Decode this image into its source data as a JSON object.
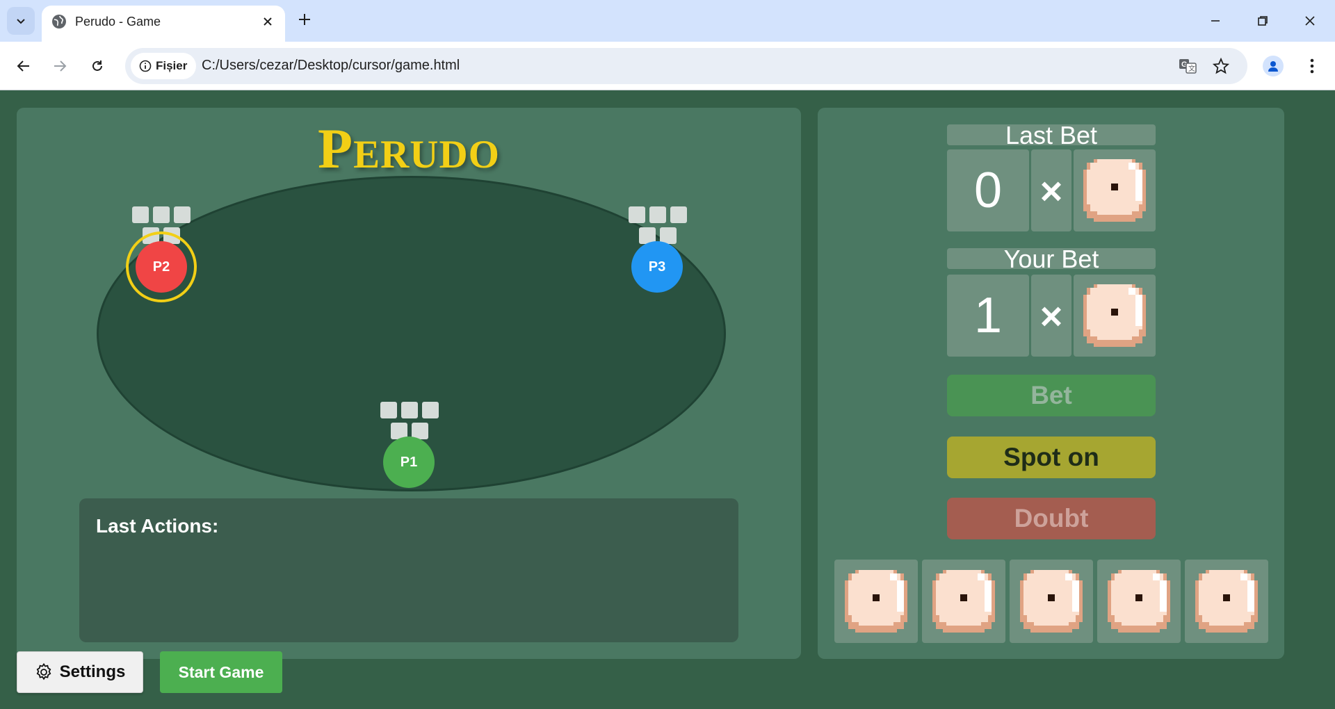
{
  "browser": {
    "tab_title": "Perudo - Game",
    "chip_label": "Fișier",
    "url": "C:/Users/cezar/Desktop/cursor/game.html"
  },
  "game": {
    "title": "Perudo",
    "players": [
      {
        "label": "P2",
        "color": "#f04545",
        "hidden_dice": 5,
        "active": true
      },
      {
        "label": "P3",
        "color": "#2196f3",
        "hidden_dice": 5,
        "active": false
      },
      {
        "label": "P1",
        "color": "#4caf50",
        "hidden_dice": 5,
        "active": false
      }
    ],
    "last_actions_title": "Last Actions:",
    "settings_label": "Settings",
    "start_label": "Start Game"
  },
  "side": {
    "last_bet_label": "Last Bet",
    "last_bet_quantity": "0",
    "last_bet_times": "×",
    "last_bet_face": 1,
    "your_bet_label": "Your Bet",
    "your_bet_quantity": "1",
    "your_bet_times": "×",
    "your_bet_face": 1,
    "bet_button": "Bet",
    "spot_on_button": "Spot on",
    "doubt_button": "Doubt",
    "my_dice": [
      1,
      1,
      1,
      1,
      1
    ]
  }
}
